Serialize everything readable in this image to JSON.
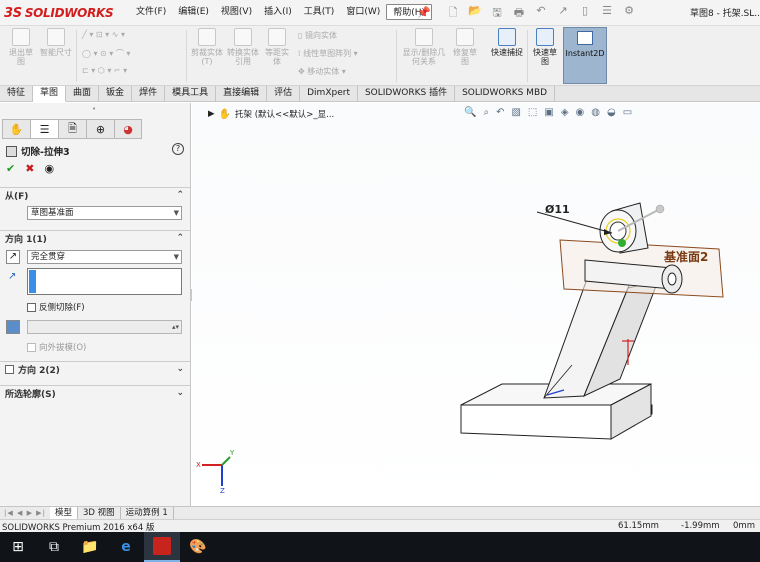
{
  "app": {
    "brand": "SOLIDWORKS",
    "document_title": "草图8 - 托架.SL..."
  },
  "menu": [
    "文件(F)",
    "编辑(E)",
    "视图(V)",
    "插入(I)",
    "工具(T)",
    "窗口(W)",
    "帮助(H)"
  ],
  "ribbon": {
    "exit_sketch": "退出草图",
    "smart_dim": "智能尺寸",
    "trim": "剪裁实体(T)",
    "convert": "转换实体引用",
    "offset": "等距实体",
    "mirror": "镜向实体",
    "linear_pattern": "线性草图阵列",
    "move": "移动实体",
    "display_relations": "显示/删除几何关系",
    "repair": "修复草图",
    "quick_snaps": "快速捕捉",
    "rapid_sketch": "快速草图",
    "instant2d": "Instant2D"
  },
  "tabs": [
    "特征",
    "草图",
    "曲面",
    "钣金",
    "焊件",
    "模具工具",
    "直接编辑",
    "评估",
    "DimXpert",
    "SOLIDWORKS 插件",
    "SOLIDWORKS MBD"
  ],
  "active_tab": "草图",
  "property_manager": {
    "title": "切除-拉伸3",
    "help": "?",
    "from_label": "从(F)",
    "from_value": "草图基准面",
    "dir1_label": "方向 1(1)",
    "dir1_end": "完全贯穿",
    "flip_side": "反侧切除(F)",
    "draft_outward": "向外拔模(O)",
    "dir2_label": "方向 2(2)",
    "selected_contours": "所选轮廓(S)"
  },
  "viewport": {
    "tree_item": "托架 (默认<<默认>_显...",
    "dimension": "Ø11",
    "plane_label": "基准面2",
    "triad_x": "X",
    "triad_y": "Y",
    "triad_z": "Z"
  },
  "bottom_tabs": [
    "模型",
    "3D 视图",
    "运动算例 1"
  ],
  "status": {
    "product": "SOLIDWORKS Premium 2016 x64 版",
    "x": "61.15mm",
    "y": "-1.99mm",
    "z": "0mm"
  },
  "colors": {
    "brand_red": "#d21e1e",
    "instant2d_bg": "#9db5cf",
    "selection_blue": "#3a8ee6",
    "plane_stroke": "#8b4a1e"
  }
}
